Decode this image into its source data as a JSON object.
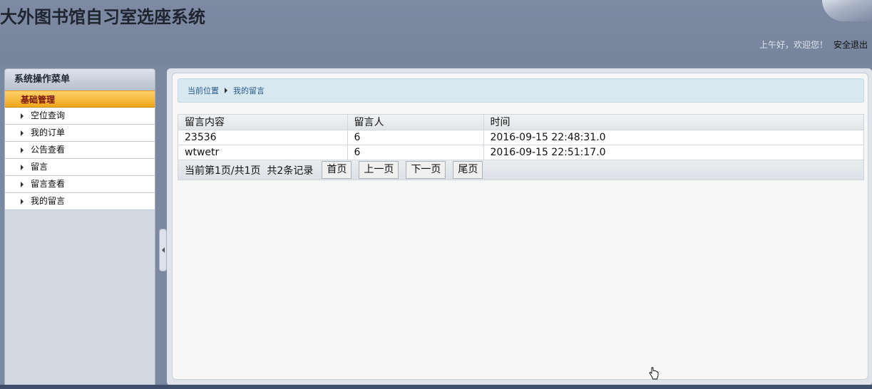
{
  "header": {
    "title": "大外图书馆自习室选座系统",
    "welcome": "上午好，欢迎您！",
    "logout": "安全退出"
  },
  "sidebar": {
    "title": "系统操作菜单",
    "group": "基础管理",
    "items": [
      {
        "label": "空位查询"
      },
      {
        "label": "我的订单"
      },
      {
        "label": "公告查看"
      },
      {
        "label": "留言"
      },
      {
        "label": "留言查看"
      },
      {
        "label": "我的留言"
      }
    ]
  },
  "breadcrumb": {
    "root": "当前位置",
    "current": "我的留言"
  },
  "table": {
    "columns": [
      "留言内容",
      "留言人",
      "时间"
    ],
    "rows": [
      {
        "content": "23536",
        "author": "6",
        "time": "2016-09-15 22:48:31.0"
      },
      {
        "content": "wtwetr",
        "author": "6",
        "time": "2016-09-15 22:51:17.0"
      }
    ]
  },
  "pager": {
    "info": "当前第1页/共1页  共2条记录",
    "first": "首页",
    "prev": "上一页",
    "next": "下一页",
    "last": "尾页"
  }
}
